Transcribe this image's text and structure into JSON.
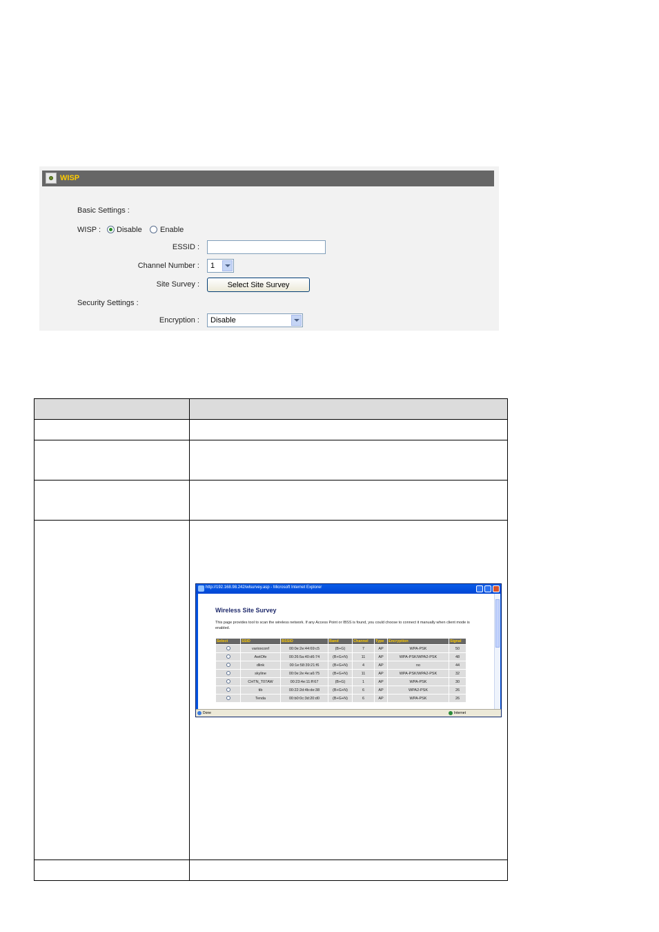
{
  "wisp": {
    "title": "WISP",
    "basic_settings_label": "Basic Settings :",
    "wisp_label": "WISP :",
    "disable_label": "Disable",
    "enable_label": "Enable",
    "selected_mode": "Disable",
    "essid_label": "ESSID :",
    "essid_value": "",
    "channel_label": "Channel Number :",
    "channel_value": "1",
    "site_survey_label": "Site Survey :",
    "site_survey_button": "Select Site Survey",
    "security_settings_label": "Security Settings :",
    "encryption_label": "Encryption :",
    "encryption_value": "Disable",
    "header_color": "#666666",
    "title_color": "#ffcc00"
  },
  "ie_window": {
    "title": "http://192.168.98.242/wlsurvey.asp - Microsoft Internet Explorer",
    "heading": "Wireless Site Survey",
    "description": "This page provides tool to scan the wireless network. If any Access Point or IBSS is found, you could choose to connect it manually when client mode is enabled.",
    "status_text": "Done",
    "zone_text": "Internet",
    "columns": [
      "Select",
      "SSID",
      "BSSID",
      "Band",
      "Channel",
      "Type",
      "Encryption",
      "Signal"
    ],
    "rows": [
      [
        "varioxconf",
        "00:0e:2e:44:69:c5",
        "(B+G)",
        "7",
        "AP",
        "WPA-PSK",
        "50"
      ],
      [
        "AwtOfe",
        "00:26:5a:40:d6:74",
        "(B+G+N)",
        "11",
        "AP",
        "WPA-PSK/WPA2-PSK",
        "48"
      ],
      [
        "dlink",
        "00:1e:58:39:21:f6",
        "(B+G+N)",
        "4",
        "AP",
        "no",
        "44"
      ],
      [
        "skyline",
        "00:0e:2e:4e:a6:75",
        "(B+G+N)",
        "11",
        "AP",
        "WPA-PSK/WPA2-PSK",
        "32"
      ],
      [
        "CHTN_T07AW",
        "00:23:4e:11:ff:67",
        "(B+G)",
        "1",
        "AP",
        "WPA-PSK",
        "30"
      ],
      [
        "tib",
        "00:22:2d:4b:de:38",
        "(B+G+N)",
        "6",
        "AP",
        "WPA2-PSK",
        "26"
      ],
      [
        "Tenda",
        "00:b0:0c:3d:20:d0",
        "(B+G+N)",
        "6",
        "AP",
        "WPA-PSK",
        "26"
      ]
    ]
  }
}
